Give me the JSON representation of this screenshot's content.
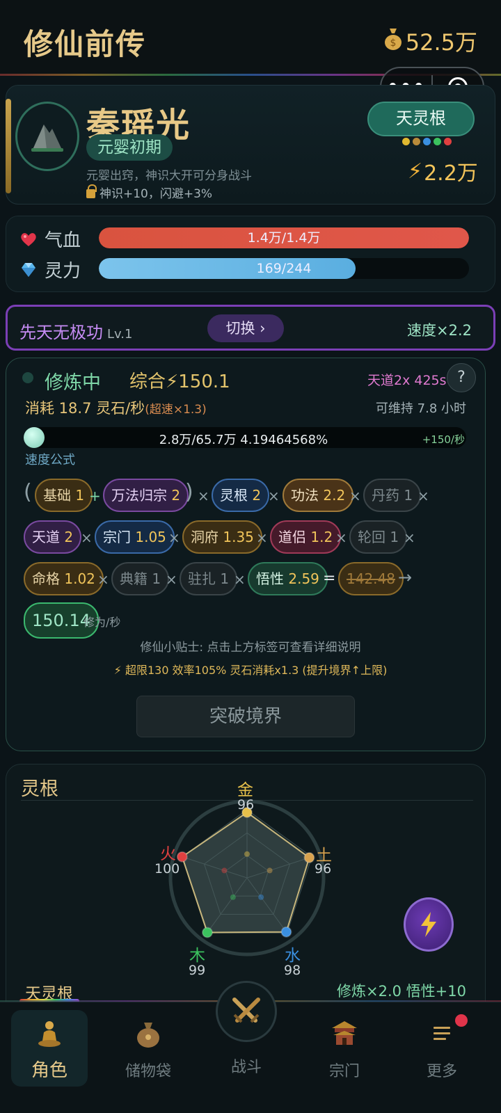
{
  "header": {
    "title": "修仙前传",
    "money": "52.5万",
    "money_icon": "money-bag-icon"
  },
  "capsule": {
    "more": "•••"
  },
  "character": {
    "name": "秦瑶光",
    "realm": "元婴初期",
    "realm_desc": "元婴出窍，神识大开可分身战斗",
    "bonus": "神识+10，闪避+3%",
    "root_button": "天灵根",
    "root_dots": [
      "#e0b830",
      "#b88a3a",
      "#3a8fe0",
      "#3bc25e",
      "#e04040"
    ],
    "power": "2.2万"
  },
  "vitals": {
    "hp": {
      "label": "气血",
      "text": "1.4万/1.4万",
      "fraction": 1.0,
      "color": "#e0574a"
    },
    "mp": {
      "label": "灵力",
      "text": "169/244",
      "fraction": 0.693,
      "color": "#5aaee0"
    }
  },
  "technique": {
    "name": "先天无极功",
    "level": "Lv.1",
    "switch": "切换 ›",
    "speed": "速度×2.2"
  },
  "cultivation": {
    "status": "修炼中",
    "total": "综合⚡150.1",
    "heaven": "天道2x 425s",
    "help": "?",
    "consume": "消耗 18.7 灵石/秒",
    "consume_over": "(超速×1.3)",
    "sustain": "可维持 7.8 小时",
    "progress_text": "2.8万/65.7万  4.19464568%",
    "progress_fraction": 0.0419,
    "rate": "+150/秒",
    "formula_label": "速度公式",
    "chips": [
      {
        "name": "基础",
        "val": "1"
      },
      {
        "name": "万法归宗",
        "val": "2"
      },
      {
        "name": "灵根",
        "val": "2"
      },
      {
        "name": "功法",
        "val": "2.2"
      },
      {
        "name": "丹药",
        "val": "1"
      },
      {
        "name": "天道",
        "val": "2"
      },
      {
        "name": "宗门",
        "val": "1.05"
      },
      {
        "name": "洞府",
        "val": "1.35"
      },
      {
        "name": "道侣",
        "val": "1.2"
      },
      {
        "name": "轮回",
        "val": "1"
      },
      {
        "name": "命格",
        "val": "1.02"
      },
      {
        "name": "典籍",
        "val": "1"
      },
      {
        "name": "驻扎",
        "val": "1"
      },
      {
        "name": "悟性",
        "val": "2.59"
      }
    ],
    "ops": {
      "plus": "+",
      "times": "×",
      "equals": "=",
      "arrow": "→",
      "lparen": "(",
      "rparen": ")"
    },
    "old_result": "142.48",
    "result": "150.14",
    "result_unit": "修为/秒",
    "tip": "修仙小贴士: 点击上方标签可查看详细说明",
    "limit": "⚡ 超限130 效率105% 灵石消耗x1.3 (提升境界↑上限)",
    "breakthrough": "突破境界"
  },
  "roots": {
    "title": "灵根",
    "elements": [
      {
        "name": "金",
        "value": 96,
        "color": "#e6c04a"
      },
      {
        "name": "土",
        "value": 96,
        "color": "#d8a24e"
      },
      {
        "name": "水",
        "value": 98,
        "color": "#3a8fe0"
      },
      {
        "name": "木",
        "value": 99,
        "color": "#3bc25e"
      },
      {
        "name": "火",
        "value": 100,
        "color": "#e04040"
      }
    ],
    "footer_name": "天灵根",
    "footer_bonus": "修炼×2.0  悟性+10"
  },
  "nav": {
    "items": [
      "角色",
      "储物袋",
      "战斗",
      "宗门",
      "更多"
    ],
    "active": "角色"
  }
}
